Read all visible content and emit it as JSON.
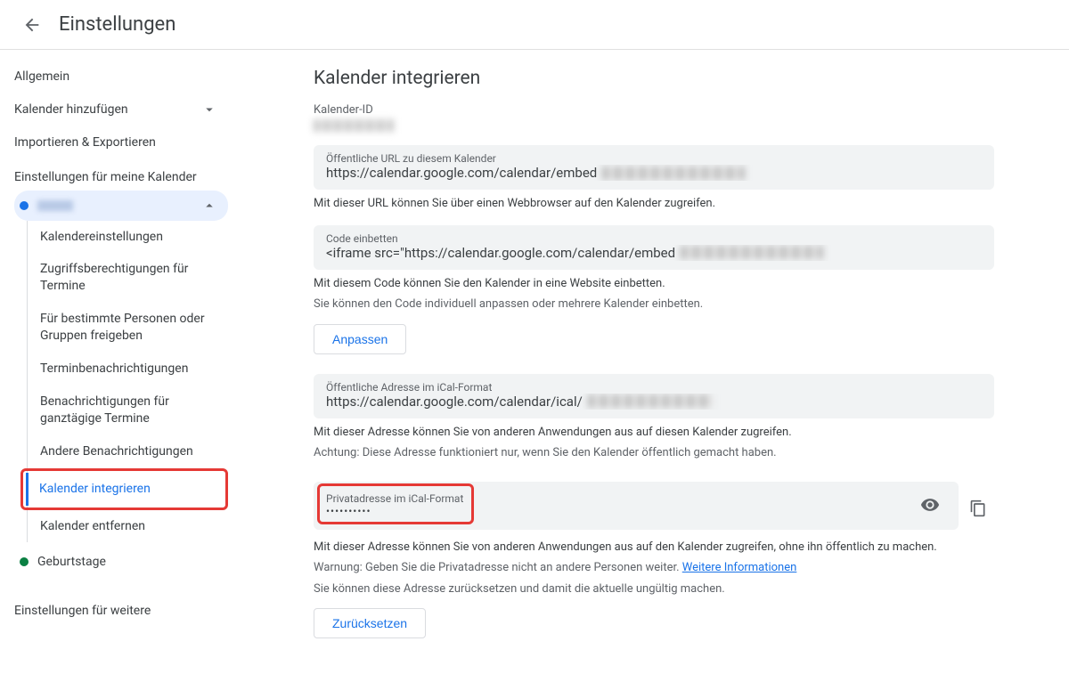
{
  "header": {
    "title": "Einstellungen"
  },
  "sidebar": {
    "general": "Allgemein",
    "addCal": "Kalender hinzufügen",
    "impExp": "Importieren & Exportieren",
    "myCalsHeader": "Einstellungen für meine Kalender",
    "items": [
      {
        "label": "Kalendereinstellungen"
      },
      {
        "label": "Zugriffsberechtigungen für Termine"
      },
      {
        "label": "Für bestimmte Personen oder Gruppen freigeben"
      },
      {
        "label": "Terminbenachrichtigungen"
      },
      {
        "label": "Benachrichtigungen für ganztägige Termine"
      },
      {
        "label": "Andere Benachrichtigungen"
      },
      {
        "label": "Kalender integrieren"
      },
      {
        "label": "Kalender entfernen"
      }
    ],
    "birthdays": "Geburtstage",
    "otherCalsHeader": "Einstellungen für weitere"
  },
  "main": {
    "title": "Kalender integrieren",
    "calIdLabel": "Kalender-ID",
    "publicUrl": {
      "label": "Öffentliche URL zu diesem Kalender",
      "value": "https://calendar.google.com/calendar/embed"
    },
    "publicUrlHint": "Mit dieser URL können Sie über einen Webbrowser auf den Kalender zugreifen.",
    "embed": {
      "label": "Code einbetten",
      "value": "<iframe src=\"https://calendar.google.com/calendar/embed"
    },
    "embedHint1": "Mit diesem Code können Sie den Kalender in eine Website einbetten.",
    "embedHint2": "Sie können den Code individuell anpassen oder mehrere Kalender einbetten.",
    "customizeBtn": "Anpassen",
    "publicIcal": {
      "label": "Öffentliche Adresse im iCal-Format",
      "value": "https://calendar.google.com/calendar/ical/"
    },
    "icalHint1": "Mit dieser Adresse können Sie von anderen Anwendungen aus auf diesen Kalender zugreifen.",
    "icalHint2": "Achtung: Diese Adresse funktioniert nur, wenn Sie den Kalender öffentlich gemacht haben.",
    "privateIcal": {
      "label": "Privatadresse im iCal-Format",
      "value": "••••••••••"
    },
    "privHint1": "Mit dieser Adresse können Sie von anderen Anwendungen aus auf den Kalender zugreifen, ohne ihn öffentlich zu machen.",
    "privHint2a": "Warnung: Geben Sie die Privatadresse nicht an andere Personen weiter. ",
    "privHint2link": "Weitere Informationen",
    "privHint3": "Sie können diese Adresse zurücksetzen und damit die aktuelle ungültig machen.",
    "resetBtn": "Zurücksetzen"
  }
}
